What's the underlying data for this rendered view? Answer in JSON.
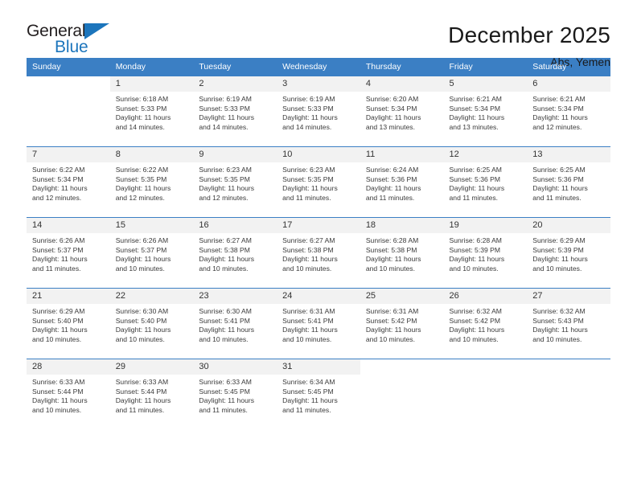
{
  "brand": {
    "name_part1": "General",
    "name_part2": "Blue",
    "accent_color": "#1c75bc"
  },
  "header": {
    "title": "December 2025",
    "location": "Abs, Yemen"
  },
  "calendar": {
    "header_color": "#3b7fc4",
    "weekdays": [
      "Sunday",
      "Monday",
      "Tuesday",
      "Wednesday",
      "Thursday",
      "Friday",
      "Saturday"
    ],
    "weeks": [
      [
        {
          "day": "",
          "info": ""
        },
        {
          "day": "1",
          "info": "Sunrise: 6:18 AM\nSunset: 5:33 PM\nDaylight: 11 hours\nand 14 minutes."
        },
        {
          "day": "2",
          "info": "Sunrise: 6:19 AM\nSunset: 5:33 PM\nDaylight: 11 hours\nand 14 minutes."
        },
        {
          "day": "3",
          "info": "Sunrise: 6:19 AM\nSunset: 5:33 PM\nDaylight: 11 hours\nand 14 minutes."
        },
        {
          "day": "4",
          "info": "Sunrise: 6:20 AM\nSunset: 5:34 PM\nDaylight: 11 hours\nand 13 minutes."
        },
        {
          "day": "5",
          "info": "Sunrise: 6:21 AM\nSunset: 5:34 PM\nDaylight: 11 hours\nand 13 minutes."
        },
        {
          "day": "6",
          "info": "Sunrise: 6:21 AM\nSunset: 5:34 PM\nDaylight: 11 hours\nand 12 minutes."
        }
      ],
      [
        {
          "day": "7",
          "info": "Sunrise: 6:22 AM\nSunset: 5:34 PM\nDaylight: 11 hours\nand 12 minutes."
        },
        {
          "day": "8",
          "info": "Sunrise: 6:22 AM\nSunset: 5:35 PM\nDaylight: 11 hours\nand 12 minutes."
        },
        {
          "day": "9",
          "info": "Sunrise: 6:23 AM\nSunset: 5:35 PM\nDaylight: 11 hours\nand 12 minutes."
        },
        {
          "day": "10",
          "info": "Sunrise: 6:23 AM\nSunset: 5:35 PM\nDaylight: 11 hours\nand 11 minutes."
        },
        {
          "day": "11",
          "info": "Sunrise: 6:24 AM\nSunset: 5:36 PM\nDaylight: 11 hours\nand 11 minutes."
        },
        {
          "day": "12",
          "info": "Sunrise: 6:25 AM\nSunset: 5:36 PM\nDaylight: 11 hours\nand 11 minutes."
        },
        {
          "day": "13",
          "info": "Sunrise: 6:25 AM\nSunset: 5:36 PM\nDaylight: 11 hours\nand 11 minutes."
        }
      ],
      [
        {
          "day": "14",
          "info": "Sunrise: 6:26 AM\nSunset: 5:37 PM\nDaylight: 11 hours\nand 11 minutes."
        },
        {
          "day": "15",
          "info": "Sunrise: 6:26 AM\nSunset: 5:37 PM\nDaylight: 11 hours\nand 10 minutes."
        },
        {
          "day": "16",
          "info": "Sunrise: 6:27 AM\nSunset: 5:38 PM\nDaylight: 11 hours\nand 10 minutes."
        },
        {
          "day": "17",
          "info": "Sunrise: 6:27 AM\nSunset: 5:38 PM\nDaylight: 11 hours\nand 10 minutes."
        },
        {
          "day": "18",
          "info": "Sunrise: 6:28 AM\nSunset: 5:38 PM\nDaylight: 11 hours\nand 10 minutes."
        },
        {
          "day": "19",
          "info": "Sunrise: 6:28 AM\nSunset: 5:39 PM\nDaylight: 11 hours\nand 10 minutes."
        },
        {
          "day": "20",
          "info": "Sunrise: 6:29 AM\nSunset: 5:39 PM\nDaylight: 11 hours\nand 10 minutes."
        }
      ],
      [
        {
          "day": "21",
          "info": "Sunrise: 6:29 AM\nSunset: 5:40 PM\nDaylight: 11 hours\nand 10 minutes."
        },
        {
          "day": "22",
          "info": "Sunrise: 6:30 AM\nSunset: 5:40 PM\nDaylight: 11 hours\nand 10 minutes."
        },
        {
          "day": "23",
          "info": "Sunrise: 6:30 AM\nSunset: 5:41 PM\nDaylight: 11 hours\nand 10 minutes."
        },
        {
          "day": "24",
          "info": "Sunrise: 6:31 AM\nSunset: 5:41 PM\nDaylight: 11 hours\nand 10 minutes."
        },
        {
          "day": "25",
          "info": "Sunrise: 6:31 AM\nSunset: 5:42 PM\nDaylight: 11 hours\nand 10 minutes."
        },
        {
          "day": "26",
          "info": "Sunrise: 6:32 AM\nSunset: 5:42 PM\nDaylight: 11 hours\nand 10 minutes."
        },
        {
          "day": "27",
          "info": "Sunrise: 6:32 AM\nSunset: 5:43 PM\nDaylight: 11 hours\nand 10 minutes."
        }
      ],
      [
        {
          "day": "28",
          "info": "Sunrise: 6:33 AM\nSunset: 5:44 PM\nDaylight: 11 hours\nand 10 minutes."
        },
        {
          "day": "29",
          "info": "Sunrise: 6:33 AM\nSunset: 5:44 PM\nDaylight: 11 hours\nand 11 minutes."
        },
        {
          "day": "30",
          "info": "Sunrise: 6:33 AM\nSunset: 5:45 PM\nDaylight: 11 hours\nand 11 minutes."
        },
        {
          "day": "31",
          "info": "Sunrise: 6:34 AM\nSunset: 5:45 PM\nDaylight: 11 hours\nand 11 minutes."
        },
        {
          "day": "",
          "info": ""
        },
        {
          "day": "",
          "info": ""
        },
        {
          "day": "",
          "info": ""
        }
      ]
    ]
  }
}
